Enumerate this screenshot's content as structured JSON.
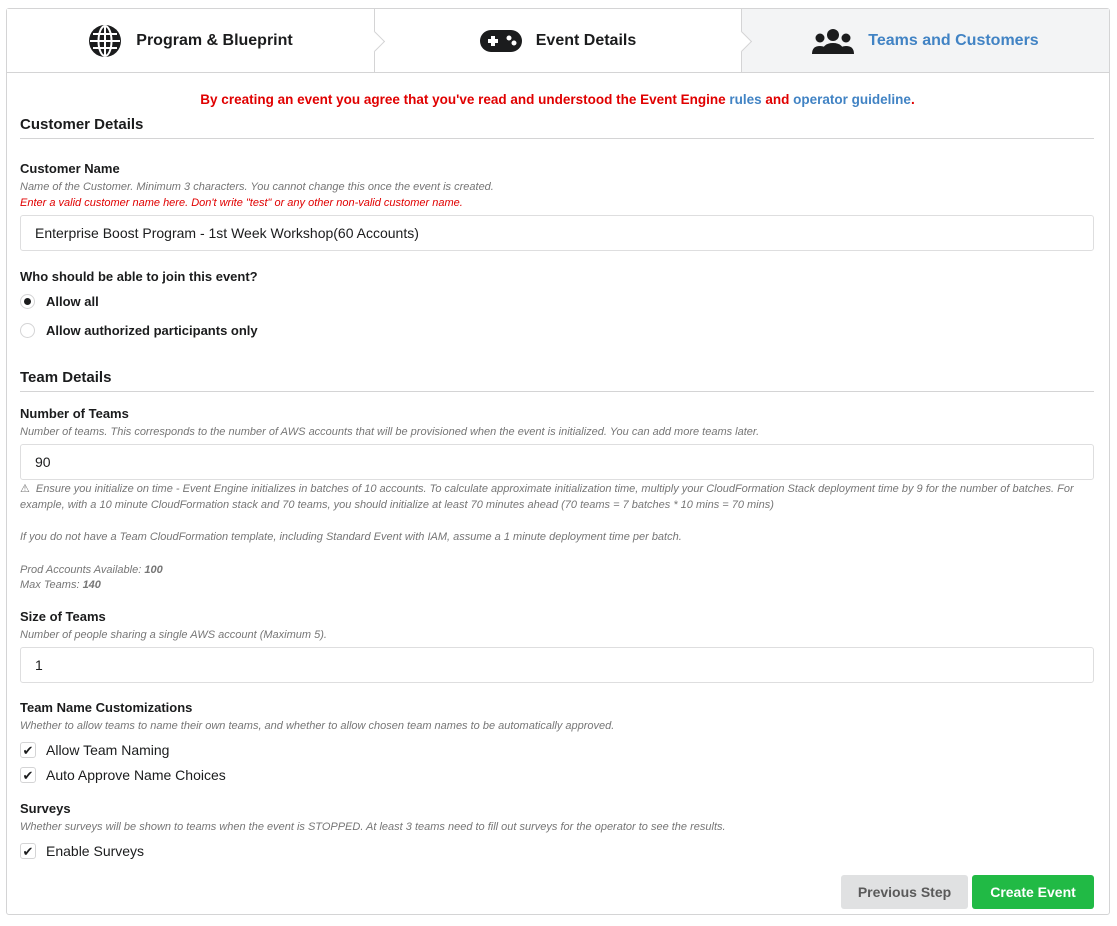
{
  "steps": [
    {
      "label": "Program & Blueprint",
      "icon": "globe-icon"
    },
    {
      "label": "Event Details",
      "icon": "gamepad-icon"
    },
    {
      "label": "Teams and Customers",
      "icon": "users-icon",
      "active": true
    }
  ],
  "agreement": {
    "prefix": "By creating an event you agree that you've read and understood the Event Engine ",
    "rules_link": "rules",
    "and": " and ",
    "guideline_link": "operator guideline",
    "suffix": "."
  },
  "customer": {
    "section_title": "Customer Details",
    "name_label": "Customer Name",
    "name_help": "Name of the Customer. Minimum 3 characters. You cannot change this once the event is created.",
    "name_warning": "Enter a valid customer name here. Don't write \"test\" or any other non-valid customer name.",
    "name_value": "Enterprise Boost Program - 1st Week Workshop(60 Accounts)",
    "join_label": "Who should be able to join this event?",
    "join_options": [
      {
        "label": "Allow all",
        "selected": true
      },
      {
        "label": "Allow authorized participants only",
        "selected": false
      }
    ]
  },
  "team": {
    "section_title": "Team Details",
    "number_label": "Number of Teams",
    "number_help": "Number of teams. This corresponds to the number of AWS accounts that will be provisioned when the event is initialized. You can add more teams later.",
    "number_value": "90",
    "init_warning": "Ensure you initialize on time - Event Engine initializes in batches of 10 accounts. To calculate approximate initialization time, multiply your CloudFormation Stack deployment time by 9 for the number of batches. For example, with a 10 minute CloudFormation stack and 70 teams, you should initialize at least 70 minutes ahead (70 teams = 7 batches * 10 mins = 70 mins)",
    "cfn_note": "If you do not have a Team CloudFormation template, including Standard Event with IAM, assume a 1 minute deployment time per batch.",
    "prod_accounts_label": "Prod Accounts Available: ",
    "prod_accounts_value": "100",
    "max_teams_label": "Max Teams: ",
    "max_teams_value": "140",
    "size_label": "Size of Teams",
    "size_help": "Number of people sharing a single AWS account (Maximum 5).",
    "size_value": "1",
    "naming_label": "Team Name Customizations",
    "naming_help": "Whether to allow teams to name their own teams, and whether to allow chosen team names to be automatically approved.",
    "naming_options": [
      {
        "label": "Allow Team Naming",
        "checked": true
      },
      {
        "label": "Auto Approve Name Choices",
        "checked": true
      }
    ],
    "surveys_label": "Surveys",
    "surveys_help": "Whether surveys will be shown to teams when the event is STOPPED. At least 3 teams need to fill out surveys for the operator to see the results.",
    "surveys_option": {
      "label": "Enable Surveys",
      "checked": true
    }
  },
  "buttons": {
    "previous": "Previous Step",
    "create": "Create Event"
  },
  "colors": {
    "link": "#4183c4",
    "warning_red": "#e00000",
    "create_green": "#21ba45",
    "secondary_grey": "#e0e1e2"
  }
}
